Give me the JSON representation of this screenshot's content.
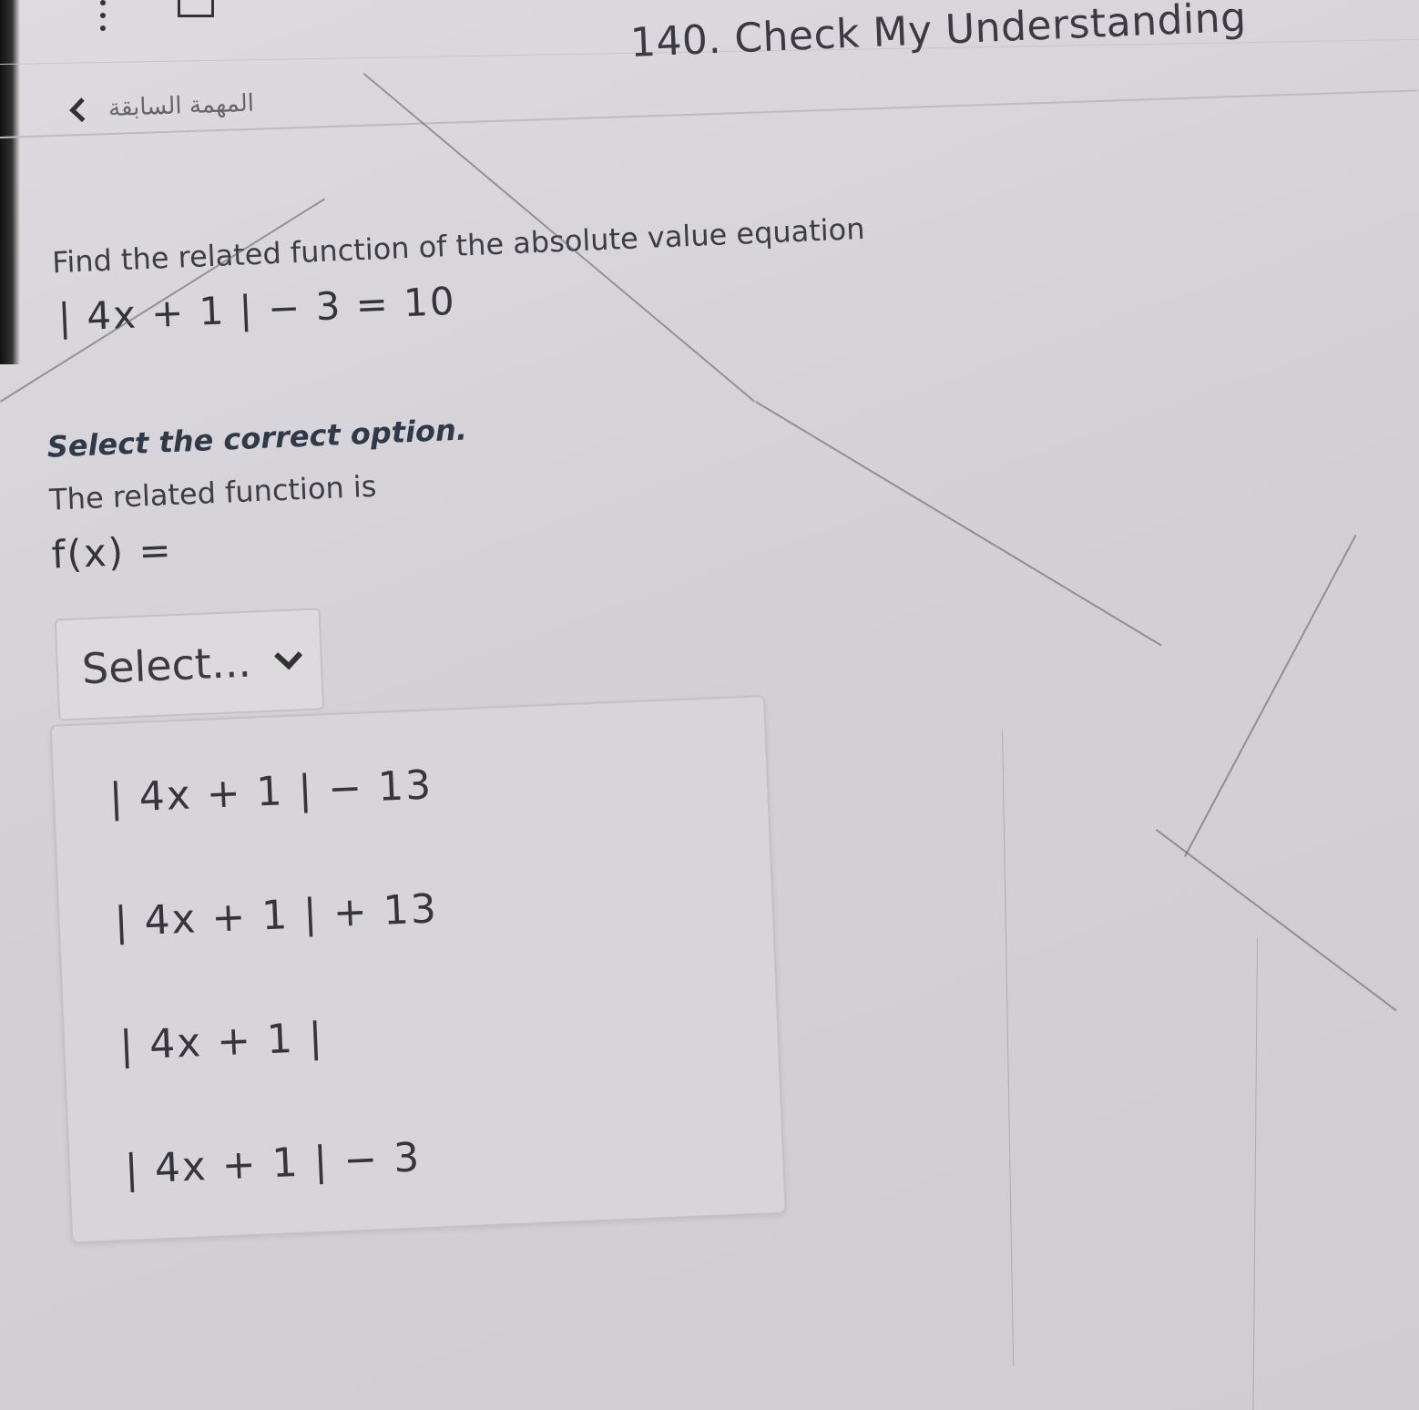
{
  "header": {
    "back_label": "المهمة السابقة",
    "title": "140. Check My Understanding"
  },
  "question": {
    "prompt": "Find the related function of the absolute value equation",
    "equation": "| 4x + 1 | − 3 = 10"
  },
  "instruction": "Select the correct option.",
  "answer": {
    "lead": "The related function is",
    "fx_label": "f(x) =",
    "select_placeholder": "Select...",
    "options": [
      "| 4x + 1 | − 13",
      "| 4x + 1 | + 13",
      "| 4x + 1 |",
      "| 4x + 1 | − 3"
    ]
  }
}
